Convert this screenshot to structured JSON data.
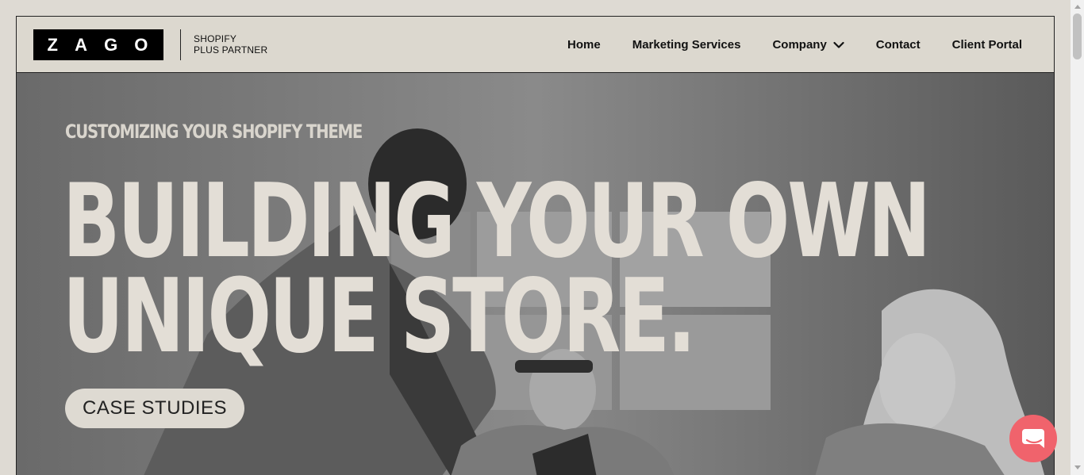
{
  "logo": {
    "letters": [
      "Z",
      "A",
      "G",
      "O"
    ],
    "partner_line1": "SHOPIFY",
    "partner_line2": "PLUS PARTNER"
  },
  "nav": {
    "home": "Home",
    "marketing": "Marketing Services",
    "company": "Company",
    "contact": "Contact",
    "portal": "Client Portal"
  },
  "hero": {
    "eyebrow": "CUSTOMIZING YOUR SHOPIFY THEME",
    "headline_line1": "BUILDING YOUR OWN",
    "headline_line2": "UNIQUE STORE.",
    "cta": "CASE STUDIES"
  },
  "icons": {
    "nav_dropdown": "chevron-down-icon",
    "chat": "chat-bubble-icon"
  },
  "colors": {
    "background": "#dcd8cf",
    "logo": "#000000",
    "chat": "#f0636c",
    "hero_text": "#e3ded6"
  }
}
